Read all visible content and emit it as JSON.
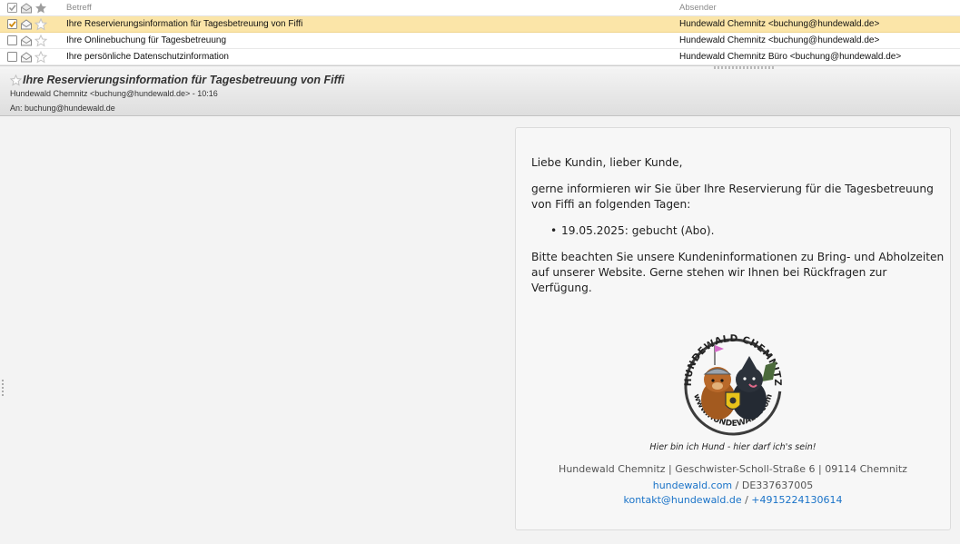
{
  "list": {
    "columns": {
      "subject": "Betreff",
      "sender": "Absender"
    },
    "messages": [
      {
        "subject": "Ihre Reservierungsinformation für Tagesbetreuung von Fiffi",
        "sender": "Hundewald Chemnitz <buchung@hundewald.de>",
        "selected": true
      },
      {
        "subject": "Ihre Onlinebuchung für Tagesbetreuung",
        "sender": "Hundewald Chemnitz <buchung@hundewald.de>",
        "selected": false
      },
      {
        "subject": "Ihre persönliche Datenschutzinformation",
        "sender": "Hundewald Chemnitz Büro <buchung@hundewald.de>",
        "selected": false
      }
    ]
  },
  "preview": {
    "subject": "Ihre Reservierungsinformation für Tagesbetreuung von Fiffi",
    "from_line": "Hundewald Chemnitz <buchung@hundewald.de> - 10:16",
    "to_line": "An: buchung@hundewald.de"
  },
  "mail": {
    "greeting": "Liebe Kundin, lieber Kunde,",
    "intro": "gerne informieren wir Sie über Ihre Reservierung für die Tagesbetreuung von Fiffi an folgenden Tagen:",
    "booking": "19.05.2025: gebucht (Abo).",
    "notice": "Bitte beachten Sie unsere Kundeninformationen zu Bring- und Abholzeiten auf unserer Website. Gerne stehen wir Ihnen bei Rückfragen zur Verfügung.",
    "logo_top_text": "HUNDEWALD CHEMNITZ",
    "logo_bottom_text": "www.HUNDEWALD.com",
    "slogan": "Hier bin ich Hund - hier darf ich's sein!",
    "footer": {
      "address": "Hundewald Chemnitz | Geschwister-Scholl-Straße 6 | 09114 Chemnitz",
      "website": "hundewald.com",
      "separator1": " / ",
      "vat": "DE337637005",
      "email": "kontakt@hundewald.de",
      "separator2": " / ",
      "phone": "+4915224130614"
    }
  },
  "icons": {
    "checkbox": "checkbox-icon",
    "envelope": "envelope-icon",
    "star": "star-icon"
  },
  "colors": {
    "selected_row": "#fbe5a8",
    "link": "#1a73c8",
    "check": "#e0a020"
  }
}
